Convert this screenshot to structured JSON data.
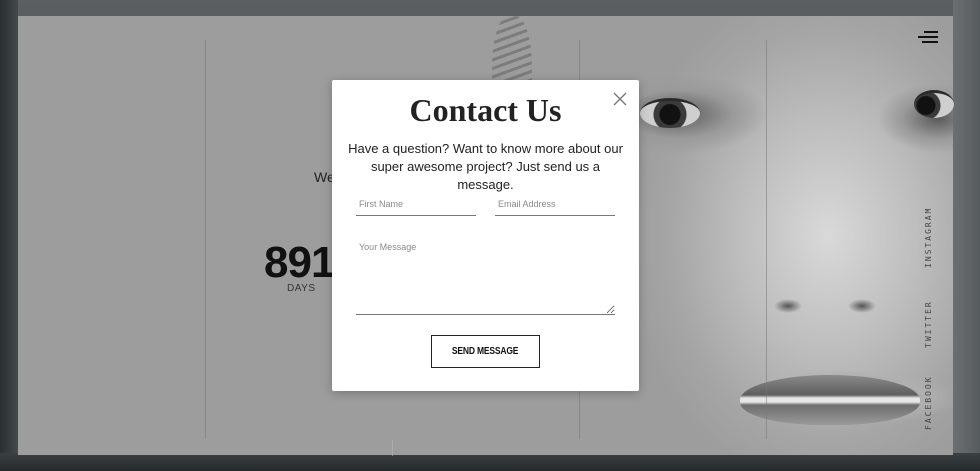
{
  "background": {
    "welcome_text": "We",
    "countdown_value": "891",
    "countdown_unit": "DAYS",
    "social_links": [
      {
        "label": "INSTAGRAM"
      },
      {
        "label": "TWITTER"
      },
      {
        "label": "FACEBOOK"
      }
    ],
    "menu_icon": "hamburger-icon"
  },
  "modal": {
    "title": "Contact Us",
    "description": "Have a question? Want to know more about our super awesome project? Just send us a message.",
    "close_icon": "close-icon",
    "first_name_placeholder": "First Name",
    "email_placeholder": "Email Address",
    "message_placeholder": "Your Message",
    "submit_label": "SEND MESSAGE"
  },
  "colors": {
    "modal_bg": "#ffffff",
    "overlay": "#9d9d9d",
    "text": "#222222"
  }
}
